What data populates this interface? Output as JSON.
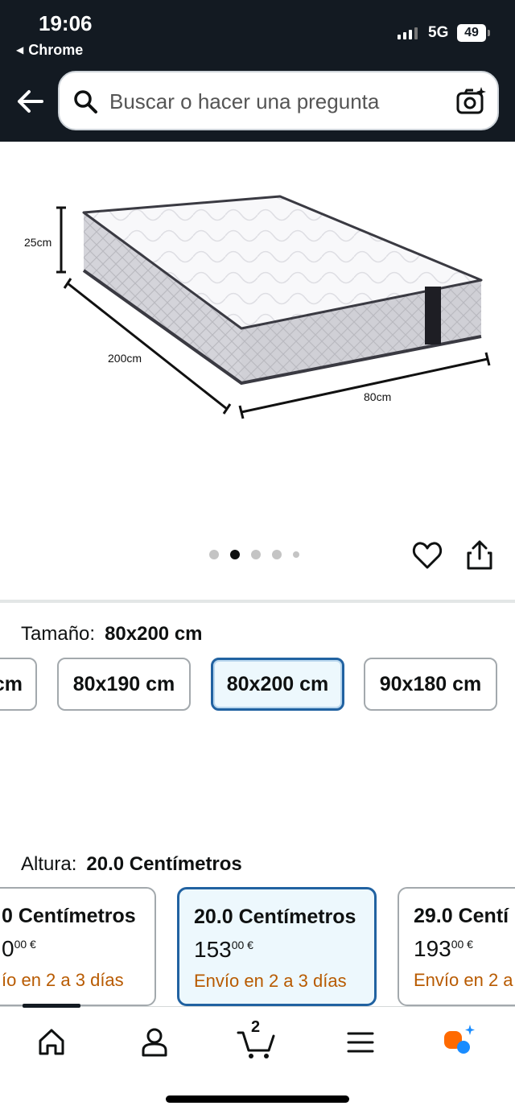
{
  "status_bar": {
    "time": "19:06",
    "back_app": "Chrome",
    "network": "5G",
    "battery": "49"
  },
  "header": {
    "back_icon": "arrow-left-icon",
    "search_placeholder": "Buscar o hacer una pregunta",
    "camera_icon": "camera-sparkle-icon"
  },
  "product_image": {
    "dimensions": {
      "height": "25cm",
      "length": "200cm",
      "width": "80cm"
    },
    "carousel_total": 5,
    "carousel_active": 2
  },
  "size_selector": {
    "label": "Tamaño:",
    "selected_value": "80x200 cm",
    "options": [
      {
        "label": "cm",
        "selected": false
      },
      {
        "label": "80x190 cm",
        "selected": false
      },
      {
        "label": "80x200 cm",
        "selected": true
      },
      {
        "label": "90x180 cm",
        "selected": false
      }
    ]
  },
  "height_selector": {
    "label": "Altura:",
    "selected_value": "20.0 Centímetros",
    "options": [
      {
        "title": "0 Centímetros",
        "price_whole": "0",
        "price_frac": "00 €",
        "delivery": "ío en 2 a 3 días",
        "selected": false
      },
      {
        "title": "20.0 Centímetros",
        "price_whole": "153",
        "price_frac": "00 €",
        "delivery": "Envío en 2 a 3 días",
        "selected": true
      },
      {
        "title": "29.0 Centí",
        "price_whole": "193",
        "price_frac": "00 €",
        "delivery": "Envío en 2 a",
        "selected": false
      }
    ]
  },
  "bottom_nav": {
    "cart_count": "2",
    "items": [
      "home-icon",
      "account-icon",
      "cart-icon",
      "menu-icon",
      "rufus-ai-icon"
    ]
  },
  "colors": {
    "header_bg": "#131a22",
    "selected_border": "#2162a1",
    "selected_bg": "#edf8fd",
    "delivery_text": "#b85a00",
    "rufus_orange": "#ff6a00",
    "rufus_blue": "#1a8cff"
  }
}
